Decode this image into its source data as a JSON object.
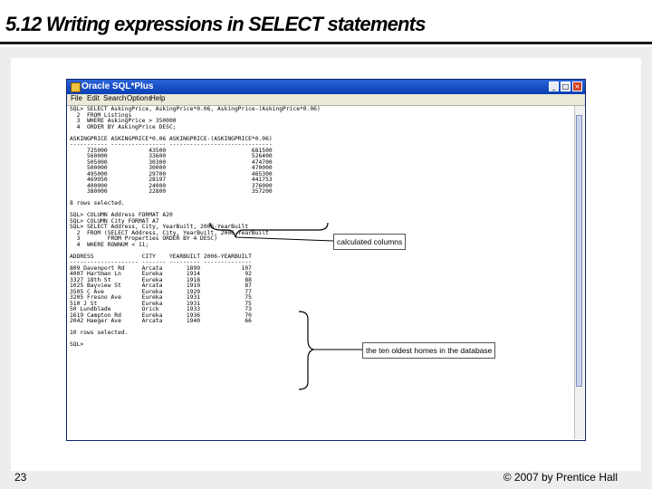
{
  "slide": {
    "title": "5.12 Writing expressions in SELECT statements",
    "page_number": "23",
    "copyright": "© 2007 by Prentice Hall"
  },
  "window": {
    "title": "Oracle SQL*Plus",
    "menu": [
      "File",
      "Edit",
      "Search",
      "Options",
      "Help"
    ],
    "controls": {
      "minimize": "_",
      "maximize": "□",
      "close": "×"
    },
    "console_lines": [
      "SQL> SELECT AskingPrice, AskingPrice*0.06, AskingPrice-(AskingPrice*0.06)",
      "  2  FROM Listings",
      "  3  WHERE AskingPrice > 350000",
      "  4  ORDER BY AskingPrice DESC;",
      "",
      "ASKINGPRICE ASKINGPRICE*0.06 ASKINGPRICE-(ASKINGPRICE*0.06)",
      "----------- ---------------- ------------------------------",
      "     725000            43500                         681500",
      "     560000            33600                         526400",
      "     505000            30300                         474700",
      "     500000            30000                         470000",
      "     495000            29700                         465300",
      "     469950            28197                         441753",
      "     400000            24000                         376000",
      "     380000            22800                         357200",
      "",
      "8 rows selected.",
      "",
      "SQL> COLUMN Address FORMAT A20",
      "SQL> COLUMN City FORMAT A7",
      "SQL> SELECT Address, City, YearBuilt, 2006-YearBuilt",
      "  2  FROM (SELECT Address, City, YearBuilt, 2006-YearBuilt",
      "  3        FROM Properties ORDER BY 4 DESC)",
      "  4  WHERE ROWNUM < 11;",
      "",
      "ADDRESS              CITY    YEARBUILT 2006-YEARBUILT",
      "-------------------- ------- --------- --------------",
      "809 Davenport Rd     Arcata       1899            107",
      "4007 Hartman Ln      Eureka       1914             92",
      "3327 18th St         Eureka       1918             88",
      "1025 Bayview St      Arcata       1919             87",
      "3505 C Ave           Eureka       1929             77",
      "3205 Fresno Ave      Eureka       1931             75",
      "510 J St             Eureka       1931             75",
      "50 Lundblade         Orick        1933             73",
      "1619 Campton Rd      Eureka       1936             70",
      "2042 Haeger Ave      Arcata       1940             66",
      "",
      "10 rows selected.",
      "",
      "SQL>"
    ]
  },
  "callouts": {
    "calculated_columns": "calculated columns",
    "oldest_homes": "the ten oldest homes in the database"
  },
  "colors": {
    "titlebar": "#0a3fb5",
    "frame_background": "#eceeee",
    "slide_text": "#000000"
  }
}
